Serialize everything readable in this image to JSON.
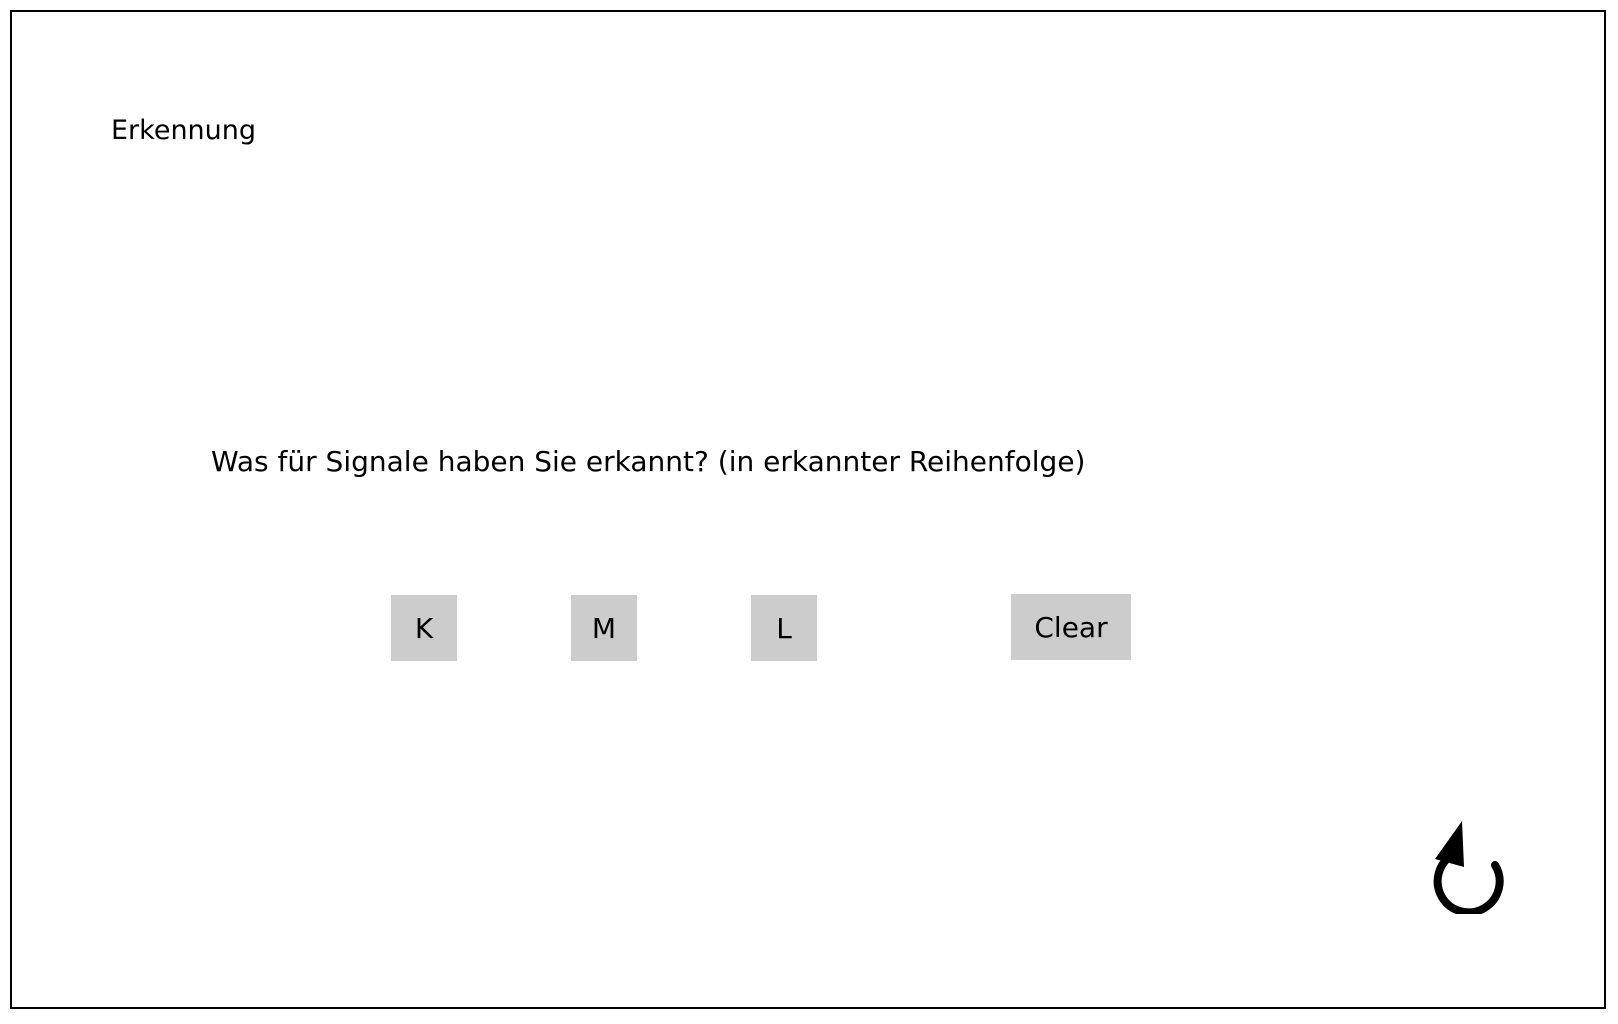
{
  "header": {
    "title": "Erkennung"
  },
  "main": {
    "question": "Was für Signale haben Sie erkannt? (in erkannter Reihenfolge)",
    "buttons": {
      "k": "K",
      "m": "M",
      "l": "L",
      "clear": "Clear"
    },
    "undo_icon": "undo-icon"
  },
  "colors": {
    "button_bg": "#cccccc",
    "frame": "#000000",
    "background": "#ffffff"
  }
}
